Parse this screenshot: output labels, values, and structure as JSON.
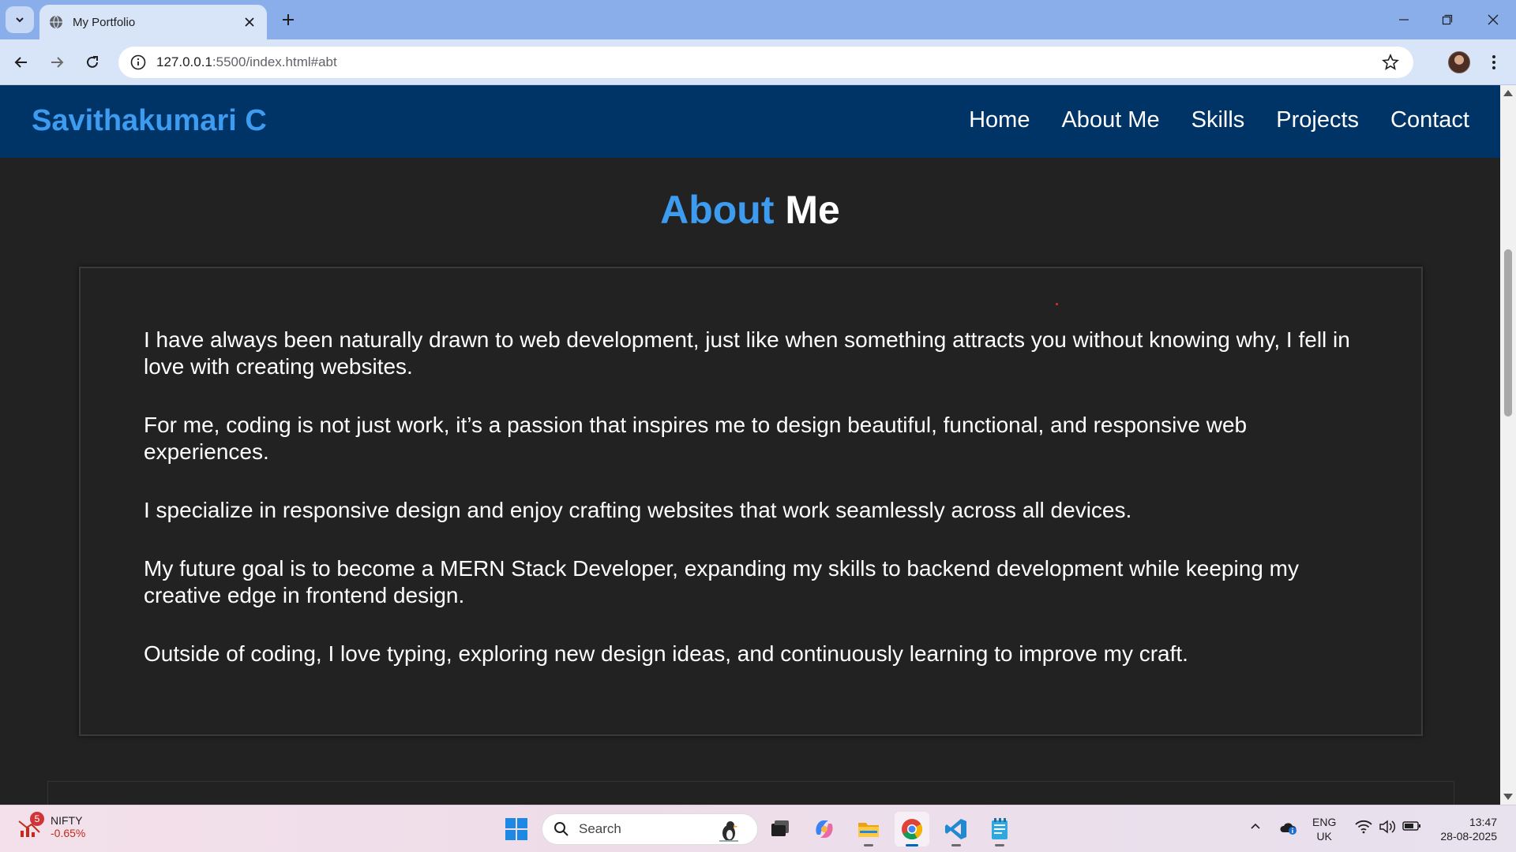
{
  "browser": {
    "tab_title": "My Portfolio",
    "url_host": "127.0.0.1",
    "url_rest": ":5500/index.html#abt"
  },
  "page": {
    "brand": "Savithakumari C",
    "nav": [
      "Home",
      "About Me",
      "Skills",
      "Projects",
      "Contact"
    ],
    "section_title_a": "About",
    "section_title_b": "Me",
    "paragraphs": [
      "I have always been naturally drawn to web development, just like when something attracts you without knowing why, I fell in love with creating websites.",
      "For me, coding is not just work, it’s a passion that inspires me to design beautiful, functional, and responsive web experiences.",
      "I specialize in responsive design and enjoy crafting websites that work seamlessly across all devices.",
      "My future goal is to become a MERN Stack Developer, expanding my skills to backend development while keeping my creative edge in frontend design.",
      "Outside of coding, I love typing, exploring new design ideas, and continuously learning to improve my craft."
    ],
    "colors": {
      "navbar": "#003366",
      "accent": "#3d9bf0",
      "background": "#222222"
    }
  },
  "taskbar": {
    "widget_badge": "5",
    "widget_name": "NIFTY",
    "widget_change": "-0.65%",
    "search_label": "Search",
    "lang_top": "ENG",
    "lang_bottom": "UK",
    "time": "13:47",
    "date": "28-08-2025"
  }
}
